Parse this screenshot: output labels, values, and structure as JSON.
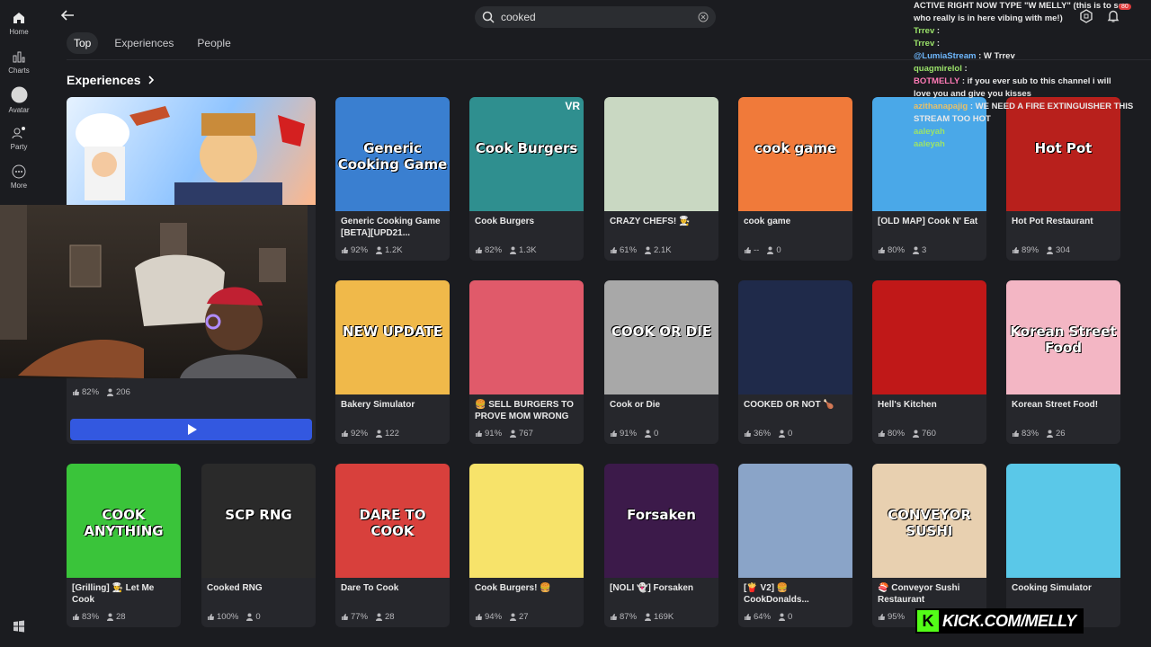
{
  "nav": {
    "home": "Home",
    "charts": "Charts",
    "avatar": "Avatar",
    "party": "Party",
    "more": "More"
  },
  "search": {
    "value": "cooked"
  },
  "tabs": [
    "Top",
    "Experiences",
    "People"
  ],
  "section": {
    "title": "Experiences"
  },
  "featured": {
    "rating": "82%",
    "players": "206"
  },
  "cards": [
    {
      "name": "Generic Cooking Game [BETA][UPD21...",
      "rating": "92%",
      "players": "1.2K",
      "thumb_text": "Generic Cooking Game",
      "bg": "#3a7fd0"
    },
    {
      "name": "Cook Burgers",
      "rating": "82%",
      "players": "1.3K",
      "thumb_text": "Cook Burgers",
      "badge": "VR",
      "bg": "#2f8f8f"
    },
    {
      "name": "CRAZY CHEFS! 👨‍🍳",
      "rating": "61%",
      "players": "2.1K",
      "thumb_text": "",
      "bg": "#c9d8c2"
    },
    {
      "name": "cook game",
      "rating": "--",
      "players": "0",
      "thumb_text": "cook game",
      "bg": "#f07a3a"
    },
    {
      "name": "[OLD MAP] Cook N' Eat",
      "rating": "80%",
      "players": "3",
      "thumb_text": "",
      "bg": "#4aa8e8"
    },
    {
      "name": "Hot Pot Restaurant",
      "rating": "89%",
      "players": "304",
      "thumb_text": "Hot Pot",
      "bg": "#b8201c"
    },
    {
      "name": "Bakery Simulator",
      "rating": "92%",
      "players": "122",
      "thumb_text": "NEW UPDATE",
      "bg": "#f0b94a"
    },
    {
      "name": "🍔 SELL BURGERS TO PROVE MOM WRONG",
      "rating": "91%",
      "players": "767",
      "thumb_text": "",
      "bg": "#e05a6a"
    },
    {
      "name": "Cook or Die",
      "rating": "91%",
      "players": "0",
      "thumb_text": "COOK OR DIE",
      "bg": "#a8a8a8"
    },
    {
      "name": "COOKED OR NOT 🍗",
      "rating": "36%",
      "players": "0",
      "thumb_text": "",
      "bg": "#1f2a4a"
    },
    {
      "name": "Hell's Kitchen",
      "rating": "80%",
      "players": "760",
      "thumb_text": "",
      "bg": "#c01818"
    },
    {
      "name": "Korean Street Food!",
      "rating": "83%",
      "players": "26",
      "thumb_text": "Korean Street Food",
      "bg": "#f3b6c4"
    },
    {
      "name": "[Grilling] 👨‍🍳 Let Me Cook",
      "rating": "83%",
      "players": "28",
      "thumb_text": "COOK ANYTHING",
      "bg": "#3ac43a"
    },
    {
      "name": "Cooked RNG",
      "rating": "100%",
      "players": "0",
      "thumb_text": "SCP RNG",
      "bg": "#2a2a2a"
    },
    {
      "name": "Dare To Cook",
      "rating": "77%",
      "players": "28",
      "thumb_text": "DARE TO COOK",
      "bg": "#d8403c"
    },
    {
      "name": "Cook Burgers! 🍔",
      "rating": "94%",
      "players": "27",
      "thumb_text": "",
      "bg": "#f7e36a"
    },
    {
      "name": "[NOLI 👻] Forsaken",
      "rating": "87%",
      "players": "169K",
      "thumb_text": "Forsaken",
      "bg": "#3c1a4a"
    },
    {
      "name": "[🍟 V2] 🍔 CookDonalds...",
      "rating": "64%",
      "players": "0",
      "thumb_text": "",
      "bg": "#8aa4c8"
    },
    {
      "name": "🍣 Conveyor Sushi Restaurant",
      "rating": "95%",
      "players": "",
      "thumb_text": "CONVEYOR SUSHI",
      "bg": "#e8d0b0"
    },
    {
      "name": "Cooking Simulator",
      "rating": "",
      "players": "",
      "thumb_text": "",
      "bg": "#5ac8e8"
    }
  ],
  "chat": [
    {
      "user": "",
      "msg": "ACTIVE RIGHT NOW TYPE \"W MELLY\" (this is to see",
      "color": ""
    },
    {
      "user": "",
      "msg": "who really is in here vibing with me!)",
      "color": ""
    },
    {
      "user": "Trrev",
      "msg": ":",
      "color": "green"
    },
    {
      "user": "Trrev",
      "msg": ":",
      "color": "green"
    },
    {
      "user": "@LumiaStream",
      "msg": ": W Trrev",
      "color": "blue"
    },
    {
      "user": "quagmirelol",
      "msg": ":",
      "color": "green"
    },
    {
      "user": "BOTMELLY",
      "msg": ": if you ever sub to this channel i will",
      "color": "pink"
    },
    {
      "user": "",
      "msg": "love you and give you kisses",
      "color": ""
    },
    {
      "user": "azithanapajig",
      "msg": ": WE NEED A FIRE EXTINGUISHER THIS",
      "color": "gold"
    },
    {
      "user": "",
      "msg": "STREAM TOO HOT",
      "color": ""
    },
    {
      "user": "aaleyah",
      "msg": "",
      "color": "green"
    },
    {
      "user": "aaleyah",
      "msg": "",
      "color": "green"
    }
  ],
  "notifications": {
    "count": "80"
  },
  "watermark": {
    "text": "KICK.COM/MELLY",
    "logo": "K"
  }
}
